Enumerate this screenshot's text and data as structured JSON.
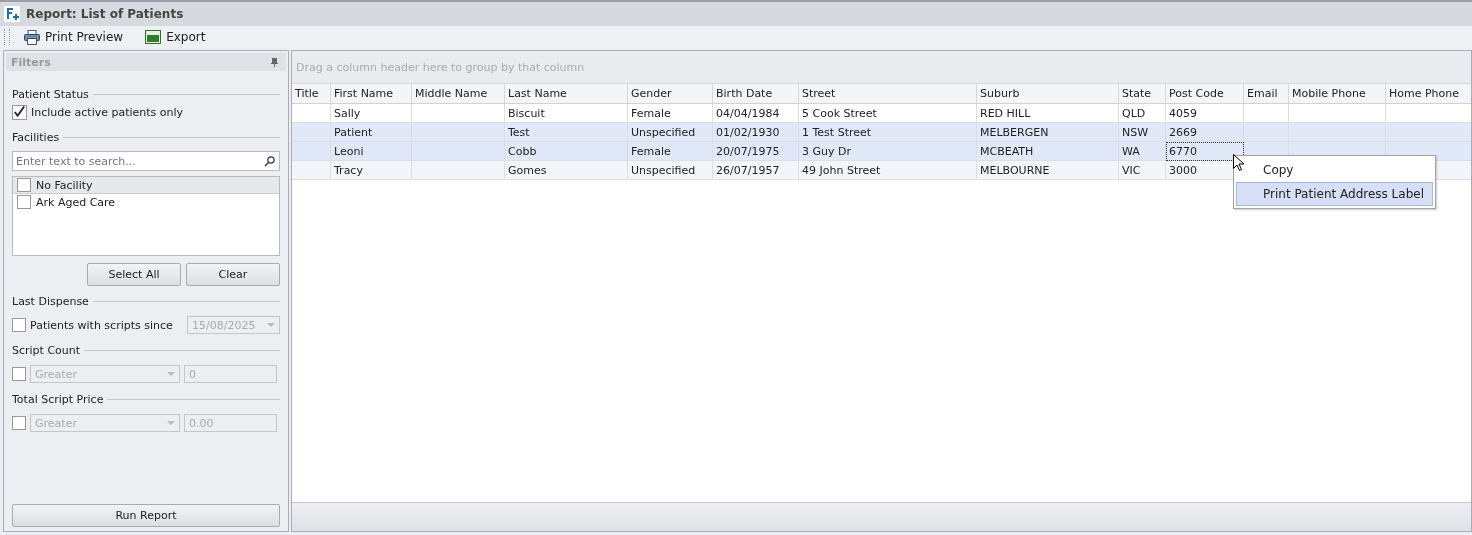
{
  "window": {
    "title": "Report: List of Patients"
  },
  "toolbar": [
    {
      "label": "Print Preview",
      "kind": "print"
    },
    {
      "label": "Export",
      "kind": "xls"
    }
  ],
  "filters": {
    "title": "Filters",
    "patient_status": {
      "heading": "Patient Status",
      "checkbox": {
        "label": "Include active patients only",
        "checked": true
      }
    },
    "facilities": {
      "heading": "Facilities",
      "search": {
        "placeholder": "Enter text to search..."
      },
      "items": [
        {
          "label": "No Facility",
          "checked": false,
          "selected": true
        },
        {
          "label": "Ark Aged Care",
          "checked": false,
          "selected": false
        }
      ],
      "buttons": [
        "Select All",
        "Clear"
      ]
    },
    "last_dispense": {
      "heading": "Last Dispense",
      "checkbox": {
        "label": "Patients with scripts since",
        "checked": false
      },
      "date": {
        "value": "15/08/2025",
        "disabled": true
      }
    },
    "script_count": {
      "heading": "Script Count",
      "checked": false,
      "operator": {
        "value": "Greater",
        "disabled": true
      },
      "amount": {
        "value": "0",
        "disabled": true
      }
    },
    "total_script_price": {
      "heading": "Total Script Price",
      "checked": false,
      "operator": {
        "value": "Greater",
        "disabled": true
      },
      "amount": {
        "value": "0.00",
        "disabled": true
      }
    },
    "run_button": "Run Report"
  },
  "grid": {
    "group_panel_hint": "Drag a column header here to group by that column",
    "columns": [
      "Title",
      "First Name",
      "Middle Name",
      "Last Name",
      "Gender",
      "Birth Date",
      "Street",
      "Suburb",
      "State",
      "Post Code",
      "Email",
      "Mobile Phone",
      "Home Phone"
    ],
    "rows": [
      {
        "cells": [
          {
            "focused": false
          },
          {
            "text": "Sally",
            "focused": false
          },
          {
            "focused": false
          },
          {
            "text": "Biscuit",
            "focused": false
          },
          {
            "text": "Female",
            "focused": false
          },
          {
            "text": "04/04/1984",
            "focused": false
          },
          {
            "text": "5 Cook Street",
            "focused": false
          },
          {
            "text": "RED HILL",
            "focused": false
          },
          {
            "text": "QLD",
            "focused": false
          },
          {
            "text": "4059",
            "focused": false
          },
          {
            "focused": false
          },
          {
            "focused": false
          },
          {
            "focused": false
          }
        ],
        "selected": false
      },
      {
        "cells": [
          {
            "focused": false
          },
          {
            "text": "Patient",
            "focused": false
          },
          {
            "focused": false
          },
          {
            "text": "Test",
            "focused": false
          },
          {
            "text": "Unspecified",
            "focused": false
          },
          {
            "text": "01/02/1930",
            "focused": false
          },
          {
            "text": "1 Test Street",
            "focused": false
          },
          {
            "text": "MELBERGEN",
            "focused": false
          },
          {
            "text": "NSW",
            "focused": false
          },
          {
            "text": "2669",
            "focused": false
          },
          {
            "focused": false
          },
          {
            "focused": false
          },
          {
            "focused": false
          }
        ],
        "selected": true
      },
      {
        "cells": [
          {
            "focused": false
          },
          {
            "text": "Leoni",
            "focused": false
          },
          {
            "focused": false
          },
          {
            "text": "Cobb",
            "focused": false
          },
          {
            "text": "Female",
            "focused": false
          },
          {
            "text": "20/07/1975",
            "focused": false
          },
          {
            "text": "3 Guy Dr",
            "focused": false
          },
          {
            "text": "MCBEATH",
            "focused": false
          },
          {
            "text": "WA",
            "focused": false
          },
          {
            "text": "6770",
            "focused": true
          },
          {
            "focused": false
          },
          {
            "focused": false
          },
          {
            "focused": false
          }
        ],
        "selected": true
      },
      {
        "cells": [
          {
            "focused": false
          },
          {
            "text": "Tracy",
            "focused": false
          },
          {
            "focused": false
          },
          {
            "text": "Gomes",
            "focused": false
          },
          {
            "text": "Unspecified",
            "focused": false
          },
          {
            "text": "26/07/1957",
            "focused": false
          },
          {
            "text": "49 John Street",
            "focused": false
          },
          {
            "text": "MELBOURNE",
            "focused": false
          },
          {
            "text": "VIC",
            "focused": false
          },
          {
            "text": "3000",
            "focused": false
          },
          {},
          {},
          {
            "focused": false
          }
        ],
        "selected": false
      }
    ]
  },
  "context_menu": [
    {
      "label": "Copy",
      "selected": false
    },
    {
      "label": "Print Patient Address Label",
      "selected": true
    }
  ]
}
